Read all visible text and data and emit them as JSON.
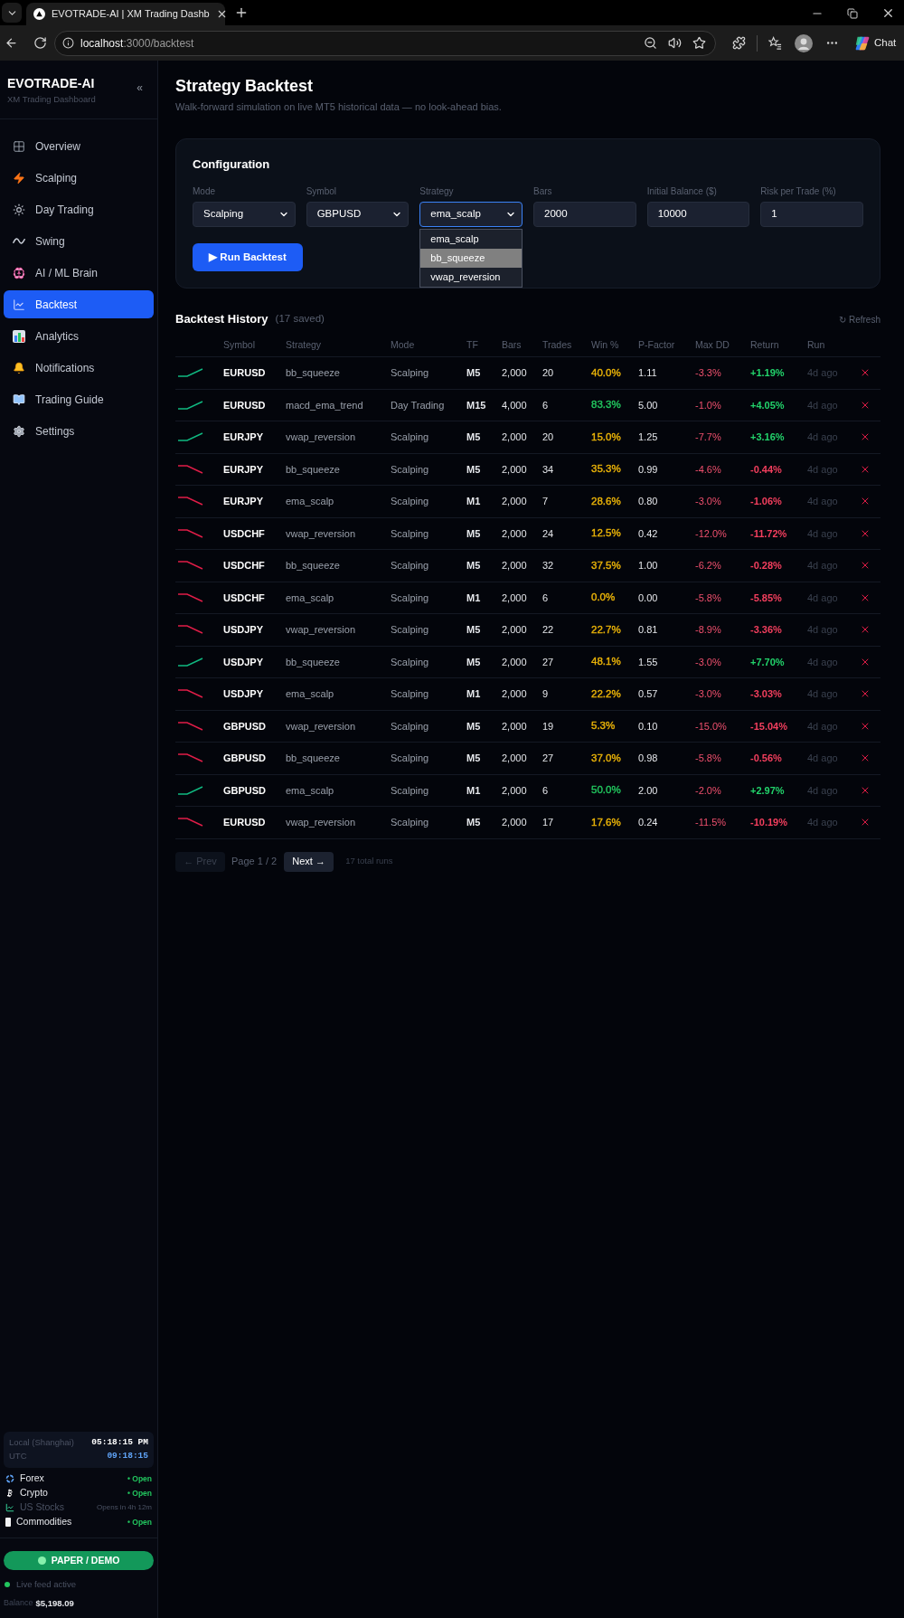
{
  "browser": {
    "tab_title": "EVOTRADE-AI | XM Trading Dashb",
    "url_host": "localhost",
    "url_path": ":3000/backtest",
    "chat_label": "Chat"
  },
  "sidebar": {
    "brand": "EVOTRADE-AI",
    "tagline": "XM Trading Dashboard",
    "collapse": "«",
    "items": [
      {
        "label": "Overview",
        "selected": false
      },
      {
        "label": "Scalping",
        "selected": false
      },
      {
        "label": "Day Trading",
        "selected": false
      },
      {
        "label": "Swing",
        "selected": false
      },
      {
        "label": "AI / ML Brain",
        "selected": false
      },
      {
        "label": "Backtest",
        "selected": true
      },
      {
        "label": "Analytics",
        "selected": false
      },
      {
        "label": "Notifications",
        "selected": false
      },
      {
        "label": "Trading Guide",
        "selected": false
      },
      {
        "label": "Settings",
        "selected": false
      }
    ],
    "clock": {
      "local_label": "Local (Shanghai)",
      "local_time": "05:18:15 PM",
      "utc_label": "UTC",
      "utc_time": "09:18:15"
    },
    "markets": [
      {
        "name": "Forex",
        "status": "• Open",
        "open": true
      },
      {
        "name": "Crypto",
        "status": "• Open",
        "open": true
      },
      {
        "name": "US Stocks",
        "status": "Opens in 4h 12m",
        "open": false
      },
      {
        "name": "Commodities",
        "status": "• Open",
        "open": true
      }
    ],
    "mode_badge": "PAPER / DEMO",
    "feed_status": "Live feed active",
    "balance_label": "Balance",
    "balance": "$5,198.09"
  },
  "page": {
    "title": "Strategy Backtest",
    "subtitle": "Walk-forward simulation on live MT5 historical data — no look-ahead bias."
  },
  "configuration": {
    "title": "Configuration",
    "fields": [
      {
        "kind": "select",
        "label": "Mode",
        "value": "Scalping",
        "expanded": false
      },
      {
        "kind": "select",
        "label": "Symbol",
        "value": "GBPUSD",
        "expanded": false
      },
      {
        "kind": "select",
        "label": "Strategy",
        "value": "ema_scalp",
        "expanded": true,
        "options": [
          {
            "label": "ema_scalp",
            "highlighted": false
          },
          {
            "label": "bb_squeeze",
            "highlighted": true
          },
          {
            "label": "vwap_reversion",
            "highlighted": false
          }
        ]
      },
      {
        "kind": "input",
        "label": "Bars",
        "value": "2000",
        "expanded": false
      },
      {
        "kind": "input",
        "label": "Initial Balance ($)",
        "value": "10000",
        "expanded": false
      },
      {
        "kind": "input",
        "label": "Risk per Trade (%)",
        "value": "1",
        "expanded": false
      }
    ],
    "run_button": "▶ Run Backtest"
  },
  "history": {
    "title": "Backtest History",
    "count": "(17 saved)",
    "refresh": "↻ Refresh",
    "columns": [
      "Symbol",
      "Strategy",
      "Mode",
      "TF",
      "Bars",
      "Trades",
      "Win %",
      "P-Factor",
      "Max DD",
      "Return",
      "Run"
    ],
    "rows": [
      {
        "kind": "up",
        "symbol": "EURUSD",
        "strategy": "bb_squeeze",
        "mode": "Scalping",
        "tf": "M5",
        "bars": "2,000",
        "trades": "20",
        "win": {
          "value": "40.0%",
          "color": "#eab308"
        },
        "pf": "1.11",
        "max_dd": "-3.3%",
        "return": "+1.19%",
        "run": "4d ago"
      },
      {
        "kind": "up",
        "symbol": "EURUSD",
        "strategy": "macd_ema_trend",
        "mode": "Day Trading",
        "tf": "M15",
        "bars": "4,000",
        "trades": "6",
        "win": {
          "value": "83.3%",
          "color": "#22c55e"
        },
        "pf": "5.00",
        "max_dd": "-1.0%",
        "return": "+4.05%",
        "run": "4d ago"
      },
      {
        "kind": "up",
        "symbol": "EURJPY",
        "strategy": "vwap_reversion",
        "mode": "Scalping",
        "tf": "M5",
        "bars": "2,000",
        "trades": "20",
        "win": {
          "value": "15.0%",
          "color": "#eab308"
        },
        "pf": "1.25",
        "max_dd": "-7.7%",
        "return": "+3.16%",
        "run": "4d ago"
      },
      {
        "kind": "down",
        "symbol": "EURJPY",
        "strategy": "bb_squeeze",
        "mode": "Scalping",
        "tf": "M5",
        "bars": "2,000",
        "trades": "34",
        "win": {
          "value": "35.3%",
          "color": "#eab308"
        },
        "pf": "0.99",
        "max_dd": "-4.6%",
        "return": "-0.44%",
        "run": "4d ago"
      },
      {
        "kind": "down",
        "symbol": "EURJPY",
        "strategy": "ema_scalp",
        "mode": "Scalping",
        "tf": "M1",
        "bars": "2,000",
        "trades": "7",
        "win": {
          "value": "28.6%",
          "color": "#eab308"
        },
        "pf": "0.80",
        "max_dd": "-3.0%",
        "return": "-1.06%",
        "run": "4d ago"
      },
      {
        "kind": "down",
        "symbol": "USDCHF",
        "strategy": "vwap_reversion",
        "mode": "Scalping",
        "tf": "M5",
        "bars": "2,000",
        "trades": "24",
        "win": {
          "value": "12.5%",
          "color": "#eab308"
        },
        "pf": "0.42",
        "max_dd": "-12.0%",
        "return": "-11.72%",
        "run": "4d ago"
      },
      {
        "kind": "down",
        "symbol": "USDCHF",
        "strategy": "bb_squeeze",
        "mode": "Scalping",
        "tf": "M5",
        "bars": "2,000",
        "trades": "32",
        "win": {
          "value": "37.5%",
          "color": "#eab308"
        },
        "pf": "1.00",
        "max_dd": "-6.2%",
        "return": "-0.28%",
        "run": "4d ago"
      },
      {
        "kind": "down",
        "symbol": "USDCHF",
        "strategy": "ema_scalp",
        "mode": "Scalping",
        "tf": "M1",
        "bars": "2,000",
        "trades": "6",
        "win": {
          "value": "0.0%",
          "color": "#eab308"
        },
        "pf": "0.00",
        "max_dd": "-5.8%",
        "return": "-5.85%",
        "run": "4d ago"
      },
      {
        "kind": "down",
        "symbol": "USDJPY",
        "strategy": "vwap_reversion",
        "mode": "Scalping",
        "tf": "M5",
        "bars": "2,000",
        "trades": "22",
        "win": {
          "value": "22.7%",
          "color": "#eab308"
        },
        "pf": "0.81",
        "max_dd": "-8.9%",
        "return": "-3.36%",
        "run": "4d ago"
      },
      {
        "kind": "up",
        "symbol": "USDJPY",
        "strategy": "bb_squeeze",
        "mode": "Scalping",
        "tf": "M5",
        "bars": "2,000",
        "trades": "27",
        "win": {
          "value": "48.1%",
          "color": "#eab308"
        },
        "pf": "1.55",
        "max_dd": "-3.0%",
        "return": "+7.70%",
        "run": "4d ago"
      },
      {
        "kind": "down",
        "symbol": "USDJPY",
        "strategy": "ema_scalp",
        "mode": "Scalping",
        "tf": "M1",
        "bars": "2,000",
        "trades": "9",
        "win": {
          "value": "22.2%",
          "color": "#eab308"
        },
        "pf": "0.57",
        "max_dd": "-3.0%",
        "return": "-3.03%",
        "run": "4d ago"
      },
      {
        "kind": "down",
        "symbol": "GBPUSD",
        "strategy": "vwap_reversion",
        "mode": "Scalping",
        "tf": "M5",
        "bars": "2,000",
        "trades": "19",
        "win": {
          "value": "5.3%",
          "color": "#eab308"
        },
        "pf": "0.10",
        "max_dd": "-15.0%",
        "return": "-15.04%",
        "run": "4d ago"
      },
      {
        "kind": "down",
        "symbol": "GBPUSD",
        "strategy": "bb_squeeze",
        "mode": "Scalping",
        "tf": "M5",
        "bars": "2,000",
        "trades": "27",
        "win": {
          "value": "37.0%",
          "color": "#eab308"
        },
        "pf": "0.98",
        "max_dd": "-5.8%",
        "return": "-0.56%",
        "run": "4d ago"
      },
      {
        "kind": "up",
        "symbol": "GBPUSD",
        "strategy": "ema_scalp",
        "mode": "Scalping",
        "tf": "M1",
        "bars": "2,000",
        "trades": "6",
        "win": {
          "value": "50.0%",
          "color": "#22c55e"
        },
        "pf": "2.00",
        "max_dd": "-2.0%",
        "return": "+2.97%",
        "run": "4d ago"
      },
      {
        "kind": "down",
        "symbol": "EURUSD",
        "strategy": "vwap_reversion",
        "mode": "Scalping",
        "tf": "M5",
        "bars": "2,000",
        "trades": "17",
        "win": {
          "value": "17.6%",
          "color": "#eab308"
        },
        "pf": "0.24",
        "max_dd": "-11.5%",
        "return": "-10.19%",
        "run": "4d ago"
      }
    ],
    "pagination": {
      "prev": {
        "label": "← Prev",
        "disabled": true
      },
      "page": "Page 1 / 2",
      "next": {
        "label": "Next →",
        "disabled": false
      },
      "total": "17 total runs"
    }
  }
}
